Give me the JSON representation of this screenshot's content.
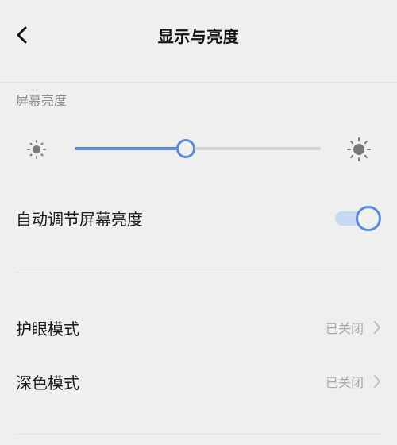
{
  "header": {
    "title": "显示与亮度"
  },
  "brightness": {
    "section_label": "屏幕亮度",
    "level_percent": 45
  },
  "auto_brightness": {
    "label": "自动调节屏幕亮度",
    "enabled": true
  },
  "settings": [
    {
      "label": "护眼模式",
      "value": "已关闭"
    },
    {
      "label": "深色模式",
      "value": "已关闭"
    }
  ],
  "colors": {
    "accent": "#5b8ad8",
    "toggle_track": "#c7d8f3",
    "background": "#efefef",
    "secondary_text": "#a8a8a8"
  },
  "icons": {
    "back": "chevron-left-icon",
    "brightness_low": "sun-small-icon",
    "brightness_high": "sun-large-icon",
    "row_arrow": "chevron-right-icon"
  }
}
